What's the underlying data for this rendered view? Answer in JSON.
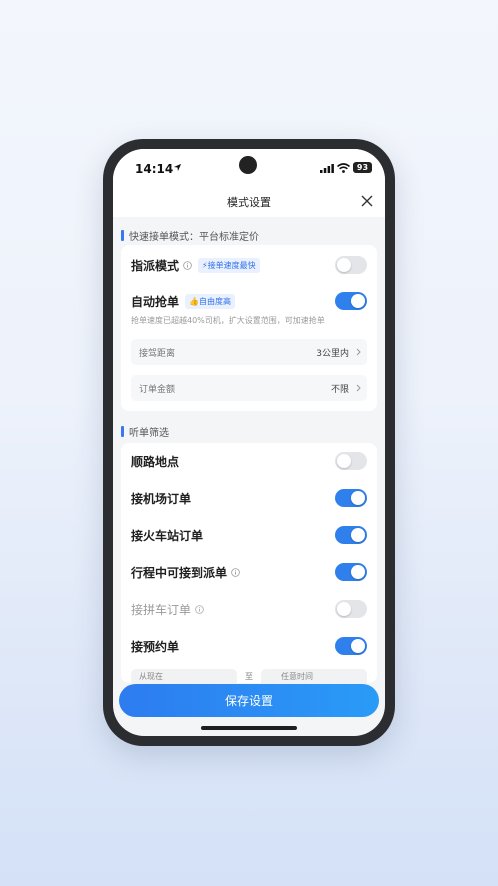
{
  "status": {
    "time": "14:14",
    "battery": "93"
  },
  "nav": {
    "title": "模式设置"
  },
  "sections": {
    "mode_header": "快速接单模式：平台标准定价",
    "filter_header": "听单筛选"
  },
  "dispatch": {
    "label": "指派模式",
    "tag": "接单速度最快",
    "on": false
  },
  "auto_grab": {
    "label": "自动抢单",
    "tag": "自由度高",
    "on": true,
    "desc": "抢单速度已超越40%司机，扩大设置范围，可加速抢单"
  },
  "pickup_distance": {
    "label": "接驾距离",
    "value": "3公里内"
  },
  "order_amount": {
    "label": "订单金额",
    "value": "不限"
  },
  "filters": [
    {
      "label": "顺路地点",
      "on": false,
      "info": false,
      "dim": false
    },
    {
      "label": "接机场订单",
      "on": true,
      "info": false,
      "dim": false
    },
    {
      "label": "接火车站订单",
      "on": true,
      "info": false,
      "dim": false
    },
    {
      "label": "行程中可接到派单",
      "on": true,
      "info": true,
      "dim": false
    },
    {
      "label": "接拼车订单",
      "on": false,
      "info": true,
      "dim": true
    },
    {
      "label": "接预约单",
      "on": true,
      "info": false,
      "dim": false
    }
  ],
  "partial_row": {
    "left": "从现在",
    "mid": "至",
    "right": "任意时间"
  },
  "save_button": "保存设置",
  "colors": {
    "accent": "#2f80ed",
    "toggle_off": "#e4e5e8"
  }
}
